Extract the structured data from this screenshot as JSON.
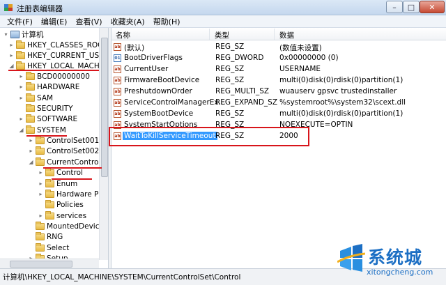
{
  "window": {
    "title": "注册表编辑器",
    "min": "–",
    "max": "□",
    "close": "✕"
  },
  "menu": [
    "文件(F)",
    "编辑(E)",
    "查看(V)",
    "收藏夹(A)",
    "帮助(H)"
  ],
  "tree": [
    {
      "label": "计算机",
      "exp": "▾",
      "icon": "computer-icon"
    },
    {
      "label": "HKEY_CLASSES_ROOT",
      "exp": "▸",
      "icon": "folder-icon"
    },
    {
      "label": "HKEY_CURRENT_USER",
      "exp": "▸",
      "icon": "folder-icon"
    },
    {
      "label": "HKEY_LOCAL_MACHINE",
      "exp": "◢",
      "icon": "folder-icon"
    },
    {
      "label": "BCD00000000",
      "exp": "▸",
      "icon": "folder-icon"
    },
    {
      "label": "HARDWARE",
      "exp": "▸",
      "icon": "folder-icon"
    },
    {
      "label": "SAM",
      "exp": "▸",
      "icon": "folder-icon"
    },
    {
      "label": "SECURITY",
      "exp": "",
      "icon": "folder-icon"
    },
    {
      "label": "SOFTWARE",
      "exp": "▸",
      "icon": "folder-icon"
    },
    {
      "label": "SYSTEM",
      "exp": "◢",
      "icon": "folder-icon"
    },
    {
      "label": "ControlSet001",
      "exp": "▸",
      "icon": "folder-icon"
    },
    {
      "label": "ControlSet002",
      "exp": "▸",
      "icon": "folder-icon"
    },
    {
      "label": "CurrentControlS",
      "exp": "◢",
      "icon": "folder-icon"
    },
    {
      "label": "Control",
      "exp": "▸",
      "icon": "folder-icon"
    },
    {
      "label": "Enum",
      "exp": "▸",
      "icon": "folder-icon"
    },
    {
      "label": "Hardware Pr",
      "exp": "▸",
      "icon": "folder-icon"
    },
    {
      "label": "Policies",
      "exp": "",
      "icon": "folder-icon"
    },
    {
      "label": "services",
      "exp": "▸",
      "icon": "folder-icon"
    },
    {
      "label": "MountedDevice",
      "exp": "",
      "icon": "folder-icon"
    },
    {
      "label": "RNG",
      "exp": "",
      "icon": "folder-icon"
    },
    {
      "label": "Select",
      "exp": "",
      "icon": "folder-icon"
    },
    {
      "label": "Setup",
      "exp": "▸",
      "icon": "folder-icon"
    }
  ],
  "columns": {
    "name": "名称",
    "type": "类型",
    "data": "数据"
  },
  "values": [
    {
      "icon": "ab",
      "name": "(默认)",
      "type": "REG_SZ",
      "data": "(数值未设置)"
    },
    {
      "icon": "bin",
      "name": "BootDriverFlags",
      "type": "REG_DWORD",
      "data": "0x00000000 (0)"
    },
    {
      "icon": "ab",
      "name": "CurrentUser",
      "type": "REG_SZ",
      "data": "USERNAME"
    },
    {
      "icon": "ab",
      "name": "FirmwareBootDevice",
      "type": "REG_SZ",
      "data": "multi(0)disk(0)rdisk(0)partition(1)"
    },
    {
      "icon": "ab",
      "name": "PreshutdownOrder",
      "type": "REG_MULTI_SZ",
      "data": "wuauserv gpsvc trustedinstaller"
    },
    {
      "icon": "ab",
      "name": "ServiceControlManagerEx...",
      "type": "REG_EXPAND_SZ",
      "data": "%systemroot%\\system32\\scext.dll"
    },
    {
      "icon": "ab",
      "name": "SystemBootDevice",
      "type": "REG_SZ",
      "data": "multi(0)disk(0)rdisk(0)partition(1)"
    },
    {
      "icon": "ab",
      "name": "SystemStartOptions",
      "type": "REG_SZ",
      "data": "NOEXECUTE=OPTIN"
    },
    {
      "icon": "ab",
      "name": "WaitToKillServiceTimeout",
      "type": "REG_SZ",
      "data": "2000",
      "selected": true
    }
  ],
  "status": "计算机\\HKEY_LOCAL_MACHINE\\SYSTEM\\CurrentControlSet\\Control",
  "watermark": {
    "name": "系统城",
    "url": "xitongcheng.com"
  },
  "colors": {
    "annotation": "#d8151b",
    "selection": "#3399ff",
    "brand": "#1c6fc4"
  }
}
